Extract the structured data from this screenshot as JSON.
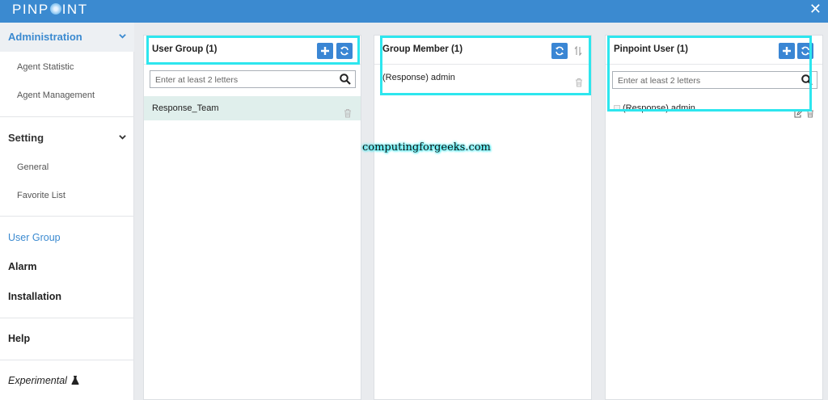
{
  "app": {
    "logo_text_left": "PINP",
    "logo_text_right": "INT"
  },
  "sidebar": {
    "administration": {
      "label": "Administration",
      "items": [
        "Agent Statistic",
        "Agent Management"
      ]
    },
    "setting": {
      "label": "Setting",
      "items": [
        "General",
        "Favorite List"
      ]
    },
    "links": {
      "user_group": "User Group",
      "alarm": "Alarm",
      "installation": "Installation",
      "help": "Help",
      "experimental": "Experimental"
    }
  },
  "user_group_panel": {
    "title": "User Group (1)",
    "search_placeholder": "Enter at least 2 letters",
    "rows": [
      "Response_Team"
    ]
  },
  "group_member_panel": {
    "title": "Group Member (1)",
    "rows": [
      "(Response) admin"
    ]
  },
  "pinpoint_user_panel": {
    "title": "Pinpoint User (1)",
    "search_placeholder": "Enter at least 2 letters",
    "rows": [
      "(Response) admin"
    ]
  },
  "watermark": "computingforgeeks.com",
  "colors": {
    "accent": "#3b8ad0",
    "highlight": "#2de6ee",
    "selected_row": "#e0efec"
  },
  "icons": [
    "close-icon",
    "chevron-down-icon",
    "plus-icon",
    "refresh-icon",
    "search-icon",
    "trash-icon",
    "sort-icon",
    "edit-icon",
    "flask-icon"
  ]
}
